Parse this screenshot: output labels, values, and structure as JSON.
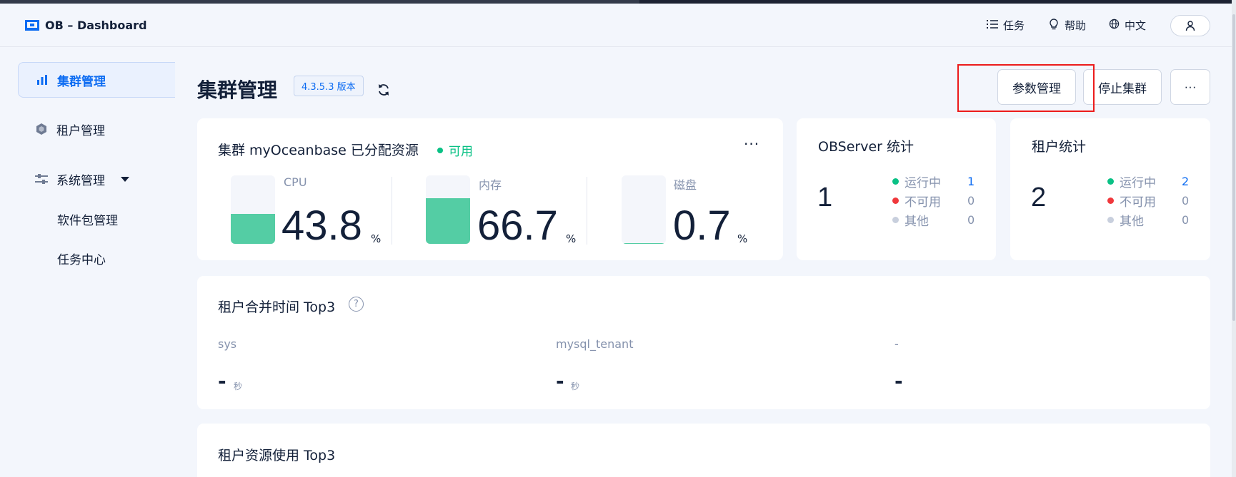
{
  "app": {
    "logo": "OB – Dashboard"
  },
  "header": {
    "tasks": "任务",
    "help": "帮助",
    "language": "中文"
  },
  "sidebar": {
    "items": [
      {
        "label": "集群管理",
        "icon": "bar-chart-icon",
        "active": true
      },
      {
        "label": "租户管理",
        "icon": "hexagon-icon"
      },
      {
        "label": "系统管理",
        "icon": "sliders-icon",
        "expanded": true
      }
    ],
    "subitems": [
      "软件包管理",
      "任务中心"
    ]
  },
  "page": {
    "title": "集群管理",
    "version": "4.3.5.3 版本",
    "actions": {
      "params": "参数管理",
      "stop": "停止集群",
      "more": "···"
    }
  },
  "resources": {
    "title": "集群 myOceanbase 已分配资源",
    "status": "可用",
    "more": "···",
    "metrics": [
      {
        "label": "CPU",
        "value": "43.8",
        "unit": "%",
        "level": 0.438
      },
      {
        "label": "内存",
        "value": "66.7",
        "unit": "%",
        "level": 0.667
      },
      {
        "label": "磁盘",
        "value": "0.7",
        "unit": "%",
        "level": 0.007
      }
    ]
  },
  "observer": {
    "title": "OBServer 统计",
    "total": "1",
    "rows": [
      {
        "label": "运行中",
        "count": "1",
        "color": "#0ac185",
        "countColor": "#0d6cf2"
      },
      {
        "label": "不可用",
        "count": "0",
        "color": "#f0383c",
        "countColor": "#8592ad"
      },
      {
        "label": "其他",
        "count": "0",
        "color": "#c8cfdd",
        "countColor": "#8592ad"
      }
    ]
  },
  "tenants": {
    "title": "租户统计",
    "total": "2",
    "rows": [
      {
        "label": "运行中",
        "count": "2",
        "color": "#0ac185",
        "countColor": "#0d6cf2"
      },
      {
        "label": "不可用",
        "count": "0",
        "color": "#f0383c",
        "countColor": "#8592ad"
      },
      {
        "label": "其他",
        "count": "0",
        "color": "#c8cfdd",
        "countColor": "#8592ad"
      }
    ]
  },
  "merge": {
    "title": "租户合并时间 Top3",
    "help": "?",
    "items": [
      {
        "name": "sys",
        "value": "-",
        "unit": "秒"
      },
      {
        "name": "mysql_tenant",
        "value": "-",
        "unit": "秒"
      },
      {
        "name": "-",
        "value": "-",
        "unit": ""
      }
    ]
  },
  "usage": {
    "title": "租户资源使用 Top3"
  }
}
